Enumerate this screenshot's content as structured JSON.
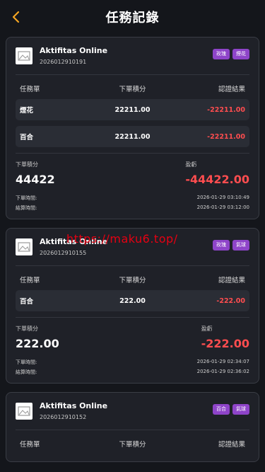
{
  "header": {
    "title": "任務記錄",
    "back_icon": "chevron-left-icon",
    "accent": "#f5a623"
  },
  "columns": {
    "task": "任務單",
    "points": "下單積分",
    "result": "認證結果"
  },
  "summary_labels": {
    "points": "下單積分",
    "profit": "盈虧"
  },
  "time_labels": {
    "order": "下單時間:",
    "settle": "結算時間:"
  },
  "colors": {
    "tag": "#8e44c9",
    "negative": "#ff4d4f",
    "card": "#1f2128"
  },
  "cards": [
    {
      "shop": "Aktifitas Online",
      "order_no": "2026012910191",
      "tags": [
        "玫瑰",
        "煙花"
      ],
      "rows": [
        {
          "name": "煙花",
          "points": "22211.00",
          "result": "-22211.00"
        },
        {
          "name": "百合",
          "points": "22211.00",
          "result": "-22211.00"
        }
      ],
      "total": "44422",
      "profit": "-44422.00",
      "order_time": "2026-01-29 03:10:49",
      "settle_time": "2026-01-29 03:12:00"
    },
    {
      "shop": "Aktifitas Online",
      "order_no": "2026012910155",
      "tags": [
        "玫瑰",
        "氣球"
      ],
      "rows": [
        {
          "name": "百合",
          "points": "222.00",
          "result": "-222.00"
        }
      ],
      "total": "222.00",
      "profit": "-222.00",
      "order_time": "2026-01-29 02:34:07",
      "settle_time": "2026-01-29 02:36:02"
    },
    {
      "shop": "Aktifitas Online",
      "order_no": "2026012910152",
      "tags": [
        "百合",
        "氣球"
      ],
      "rows": [],
      "total": "",
      "profit": "",
      "order_time": "",
      "settle_time": ""
    }
  ],
  "watermark": "https://maku6.top/"
}
